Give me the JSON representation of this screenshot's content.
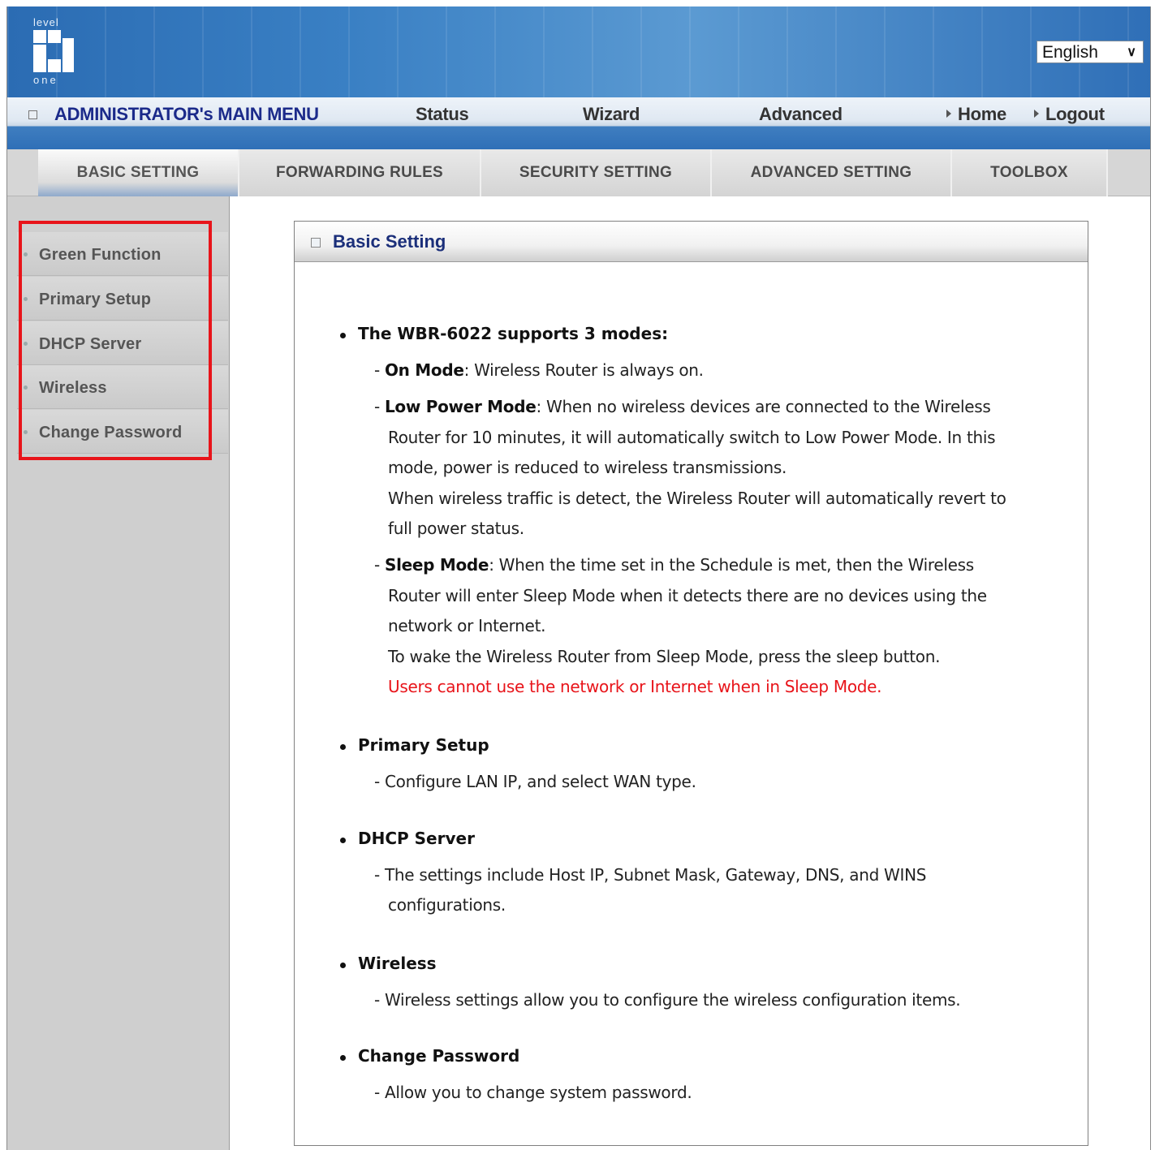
{
  "header": {
    "logo_top": "level",
    "logo_bottom": "one",
    "language": "English"
  },
  "main_menu": {
    "title": "ADMINISTRATOR's MAIN MENU",
    "items": [
      "Status",
      "Wizard",
      "Advanced"
    ],
    "home": "Home",
    "logout": "Logout"
  },
  "tabs": [
    "BASIC SETTING",
    "FORWARDING RULES",
    "SECURITY SETTING",
    "ADVANCED SETTING",
    "TOOLBOX"
  ],
  "sidebar": {
    "items": [
      "Green Function",
      "Primary Setup",
      "DHCP Server",
      "Wireless",
      "Change Password"
    ]
  },
  "panel": {
    "title": "Basic Setting",
    "modes_heading": "The WBR-6022 supports 3 modes:",
    "on_mode_label": "On Mode",
    "on_mode_text": ": Wireless Router is always on.",
    "low_label": "Low Power Mode",
    "low_text_1": ": When no wireless devices are connected to the Wireless",
    "low_text_2": "Router for 10 minutes, it will automatically switch to Low Power Mode. In this",
    "low_text_3": "mode, power is reduced to wireless transmissions.",
    "low_text_4": "When wireless traffic is detect, the Wireless Router will automatically revert to",
    "low_text_5": "full power status.",
    "sleep_label": "Sleep Mode",
    "sleep_text_1": ": When the time set in the Schedule is met, then the Wireless",
    "sleep_text_2": "Router will enter Sleep Mode when it detects there are no devices using the",
    "sleep_text_3": "network or Internet.",
    "sleep_text_4": "To wake the Wireless Router from Sleep Mode, press the sleep button.",
    "sleep_warning": "Users cannot use the network or Internet when in Sleep Mode.",
    "primary_heading": "Primary Setup",
    "primary_text": "- Configure LAN IP, and select WAN type.",
    "dhcp_heading": "DHCP Server",
    "dhcp_text_1": "- The settings include Host IP, Subnet Mask, Gateway, DNS, and WINS",
    "dhcp_text_2": "configurations.",
    "wireless_heading": "Wireless",
    "wireless_text": "- Wireless settings allow you to configure the wireless configuration items.",
    "password_heading": "Change Password",
    "password_text": "- Allow you to change system password."
  },
  "colors": {
    "banner": "#3a80c4",
    "highlight_box": "#e8141a",
    "warning_text": "#e8141a",
    "title_blue": "#1b2f7a"
  }
}
